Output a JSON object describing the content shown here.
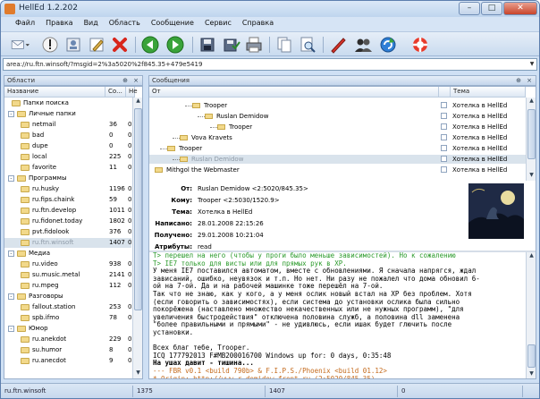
{
  "window": {
    "title": "HellEd 1.2.202"
  },
  "menu": [
    "Файл",
    "Правка",
    "Вид",
    "Область",
    "Сообщение",
    "Сервис",
    "Справка"
  ],
  "toolbar": {
    "icons": [
      "mail-icon",
      "important-icon",
      "address-book-icon",
      "edit-icon",
      "delete-icon",
      "back-icon",
      "forward-icon",
      "save-icon",
      "save-all-icon",
      "print-icon",
      "copy-icon",
      "find-icon",
      "new-icon",
      "users-icon",
      "refresh-icon",
      "help-icon"
    ]
  },
  "address": {
    "value": "area://ru.ftn.winsoft/?msgid=2%3a5020%2f845.35+479e5419"
  },
  "left_pane": {
    "title": "Области",
    "columns": {
      "name": "Название",
      "count": "Со...",
      "new": "Не"
    },
    "rows": [
      {
        "name": "Папки поиска",
        "count": "",
        "new": "",
        "level": 0,
        "toggle": ""
      },
      {
        "name": "Личные папки",
        "count": "",
        "new": "",
        "level": 0,
        "toggle": "-"
      },
      {
        "name": "netmail",
        "count": "36",
        "new": "0",
        "level": 1,
        "toggle": ""
      },
      {
        "name": "bad",
        "count": "0",
        "new": "0",
        "level": 1,
        "toggle": ""
      },
      {
        "name": "dupe",
        "count": "0",
        "new": "0",
        "level": 1,
        "toggle": ""
      },
      {
        "name": "local",
        "count": "225",
        "new": "0",
        "level": 1,
        "toggle": ""
      },
      {
        "name": "favorite",
        "count": "11",
        "new": "0",
        "level": 1,
        "toggle": ""
      },
      {
        "name": "Программы",
        "count": "",
        "new": "",
        "level": 0,
        "toggle": "-"
      },
      {
        "name": "ru.husky",
        "count": "1196",
        "new": "0",
        "level": 1,
        "toggle": ""
      },
      {
        "name": "ru.fips.chaink",
        "count": "59",
        "new": "0",
        "level": 1,
        "toggle": ""
      },
      {
        "name": "ru.ftn.develop",
        "count": "1011",
        "new": "0",
        "level": 1,
        "toggle": ""
      },
      {
        "name": "ru.fidonet.today",
        "count": "1802",
        "new": "0",
        "level": 1,
        "toggle": ""
      },
      {
        "name": "pvt.fidolook",
        "count": "376",
        "new": "0",
        "level": 1,
        "toggle": ""
      },
      {
        "name": "ru.ftn.winsoft",
        "count": "1407",
        "new": "0",
        "level": 1,
        "toggle": "",
        "selected": true
      },
      {
        "name": "Медиа",
        "count": "",
        "new": "",
        "level": 0,
        "toggle": "-"
      },
      {
        "name": "ru.video",
        "count": "938",
        "new": "0",
        "level": 1,
        "toggle": ""
      },
      {
        "name": "su.music.metal",
        "count": "2141",
        "new": "0",
        "level": 1,
        "toggle": ""
      },
      {
        "name": "ru.mpeg",
        "count": "112",
        "new": "0",
        "level": 1,
        "toggle": ""
      },
      {
        "name": "Разговоры",
        "count": "",
        "new": "",
        "level": 0,
        "toggle": "-"
      },
      {
        "name": "fallout.station",
        "count": "253",
        "new": "0",
        "level": 1,
        "toggle": ""
      },
      {
        "name": "spb.ifmo",
        "count": "78",
        "new": "0",
        "level": 1,
        "toggle": ""
      },
      {
        "name": "Юмор",
        "count": "",
        "new": "",
        "level": 0,
        "toggle": "-"
      },
      {
        "name": "ru.anekdot",
        "count": "229",
        "new": "0",
        "level": 1,
        "toggle": ""
      },
      {
        "name": "su.humor",
        "count": "8",
        "new": "0",
        "level": 1,
        "toggle": ""
      },
      {
        "name": "ru.anecdot",
        "count": "9",
        "new": "0",
        "level": 1,
        "toggle": ""
      }
    ]
  },
  "right_pane": {
    "title": "Сообщения",
    "columns": {
      "from": "От",
      "subject": "Тема"
    },
    "messages": [
      {
        "from": "Trooper",
        "subject": "Хотелка в HellEd",
        "level": 3,
        "selected": false
      },
      {
        "from": "Ruslan Demidow",
        "subject": "Хотелка в HellEd",
        "level": 4,
        "selected": false
      },
      {
        "from": "Trooper",
        "subject": "Хотелка в HellEd",
        "level": 5,
        "selected": false
      },
      {
        "from": "Vova Kravets",
        "subject": "Хотелка в HellEd",
        "level": 2,
        "selected": false
      },
      {
        "from": "Trooper",
        "subject": "Хотелка в HellEd",
        "level": 1,
        "selected": false
      },
      {
        "from": "Ruslan Demidow",
        "subject": "Хотелка в HellEd",
        "level": 2,
        "selected": true
      },
      {
        "from": "Mithgol the Webmaster",
        "subject": "Хотелка в HellEd",
        "level": 0,
        "selected": false
      }
    ],
    "header": {
      "from_label": "От:",
      "from": "Ruslan Demidow <2:5020/845.35>",
      "to_label": "Кому:",
      "to": "Trooper <2:5030/1520.9>",
      "subject_label": "Тема:",
      "subject": "Хотелка в HellEd",
      "written_label": "Написано:",
      "written": "28.01.2008 22:15:26",
      "received_label": "Получено:",
      "received": "29.01.2008 10:21:04",
      "attrs_label": "Атрибуты:",
      "attrs": "read"
    },
    "body": [
      {
        "text": "T> перешел на него (чтобы у проги было меньше зависимостей). Но к сожалению",
        "color": "#2a9a2a"
      },
      {
        "text": "T> IE7 только для висты или для прямых рук в XP.",
        "color": "#2a9a2a"
      },
      {
        "text": "У меня IE7 поставился автоматом, вместе с обновлениями. Я сначала напрягся, ждал",
        "color": "#000"
      },
      {
        "text": "зависаний, ошибко, неувязок и т.п. Но нет. Ни разу не пожалел что дома обновил 6-",
        "color": "#000"
      },
      {
        "text": "ой на 7-ой. Да и на рабочей машинке тоже перешёл на 7-ой.",
        "color": "#000"
      },
      {
        "text": "Так что не знаю, как у кого, а у меня ослик новый встал на XP без проблем. Хотя",
        "color": "#000"
      },
      {
        "text": "(если говорить о зависимостях), если система до установки ослика была сильно",
        "color": "#000"
      },
      {
        "text": "покорёжена (наставлено множество некачественных или не нужных программ), \"для",
        "color": "#000"
      },
      {
        "text": "увеличения быстродействия\" отключена половина служб, а половина dll заменена",
        "color": "#000"
      },
      {
        "text": "\"более правильными и прямыми\" - не удивлюсь, если ишак будет глючить после",
        "color": "#000"
      },
      {
        "text": "установки.",
        "color": "#000"
      },
      {
        "text": "",
        "color": "#000"
      },
      {
        "text": "Всех благ тебе, Trooper.",
        "color": "#000"
      },
      {
        "text": "ICQ 177792013      F#MB200016700  Windows up for: 0 days, 0:35:48",
        "color": "#000"
      },
      {
        "text": "На ушах давит - тишина...",
        "color": "#000",
        "bold": true
      },
      {
        "text": "--- FBR v0.1 <build 790b> & F.I.P.S./Phoenix <build 01.12>",
        "color": "#c46a1c"
      },
      {
        "text": " * Origin: http://www.r-demidow.front.ru (2:5020/845.35)",
        "color": "#c46a1c"
      }
    ]
  },
  "status": {
    "area": "ru.ftn.winsoft",
    "total": "1375",
    "current": "1407",
    "extra": "0"
  },
  "colors": {
    "accent": "#cfe0f4",
    "quote": "#2a9a2a",
    "tearline": "#c46a1c",
    "link": "#1a3fd0"
  }
}
